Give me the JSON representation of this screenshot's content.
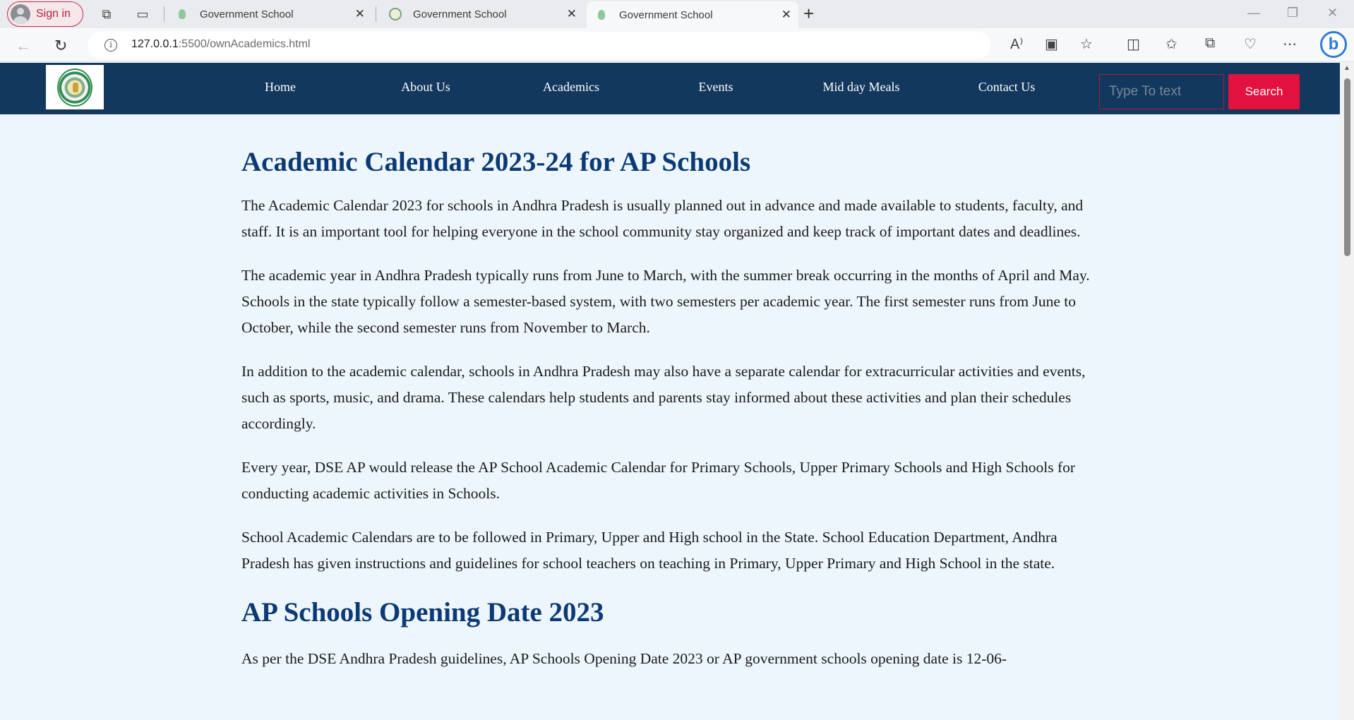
{
  "browser": {
    "signin_label": "Sign in",
    "tabs": [
      {
        "title": "Government School",
        "active": false
      },
      {
        "title": "Government School",
        "active": false
      },
      {
        "title": "Government School",
        "active": true
      }
    ],
    "new_tab_glyph": "+",
    "close_glyph": "✕",
    "url_host": "127.0.0.1",
    "url_rest": ":5500/ownAcademics.html",
    "info_glyph": "i",
    "bing_glyph": "b",
    "window_controls": {
      "minimize": "—",
      "restore": "❐",
      "close": "✕"
    },
    "toolbar_icons": [
      "read-aloud-icon",
      "immersive-reader-icon",
      "favorite-star-icon",
      "split-screen-icon",
      "favorites-icon",
      "collections-icon",
      "browser-essentials-icon",
      "more-icon"
    ]
  },
  "site": {
    "nav": [
      "Home",
      "About Us",
      "Academics",
      "Events",
      "Mid day Meals",
      "Contact Us"
    ],
    "search_placeholder": "Type To text",
    "search_button": "Search",
    "colors": {
      "nav_bg": "#12385e",
      "page_bg": "#eef6fd",
      "heading": "#0c3a75",
      "search_btn": "#e3113d"
    }
  },
  "content": {
    "heading1": "Academic Calendar 2023-24 for AP Schools",
    "paragraphs": [
      "The Academic Calendar 2023 for schools in Andhra Pradesh is usually planned out in advance and made available to students, faculty, and staff. It is an important tool for helping everyone in the school community stay organized and keep track of important dates and deadlines.",
      "The academic year in Andhra Pradesh typically runs from June to March, with the summer break occurring in the months of April and May. Schools in the state typically follow a semester-based system, with two semesters per academic year. The first semester runs from June to October, while the second semester runs from November to March.",
      "In addition to the academic calendar, schools in Andhra Pradesh may also have a separate calendar for extracurricular activities and events, such as sports, music, and drama. These calendars help students and parents stay informed about these activities and plan their schedules accordingly.",
      "Every year, DSE AP would release the AP School Academic Calendar for Primary Schools, Upper Primary Schools and High Schools for conducting academic activities in Schools.",
      "School Academic Calendars are to be followed in Primary, Upper and High school in the State. School Education Department, Andhra Pradesh has given instructions and guidelines for school teachers on teaching in Primary, Upper Primary and High School in the state."
    ],
    "heading2": "AP Schools Opening Date 2023",
    "partial_paragraph": "As per the DSE Andhra Pradesh guidelines, AP Schools Opening Date 2023 or AP government schools opening date is 12-06-"
  }
}
